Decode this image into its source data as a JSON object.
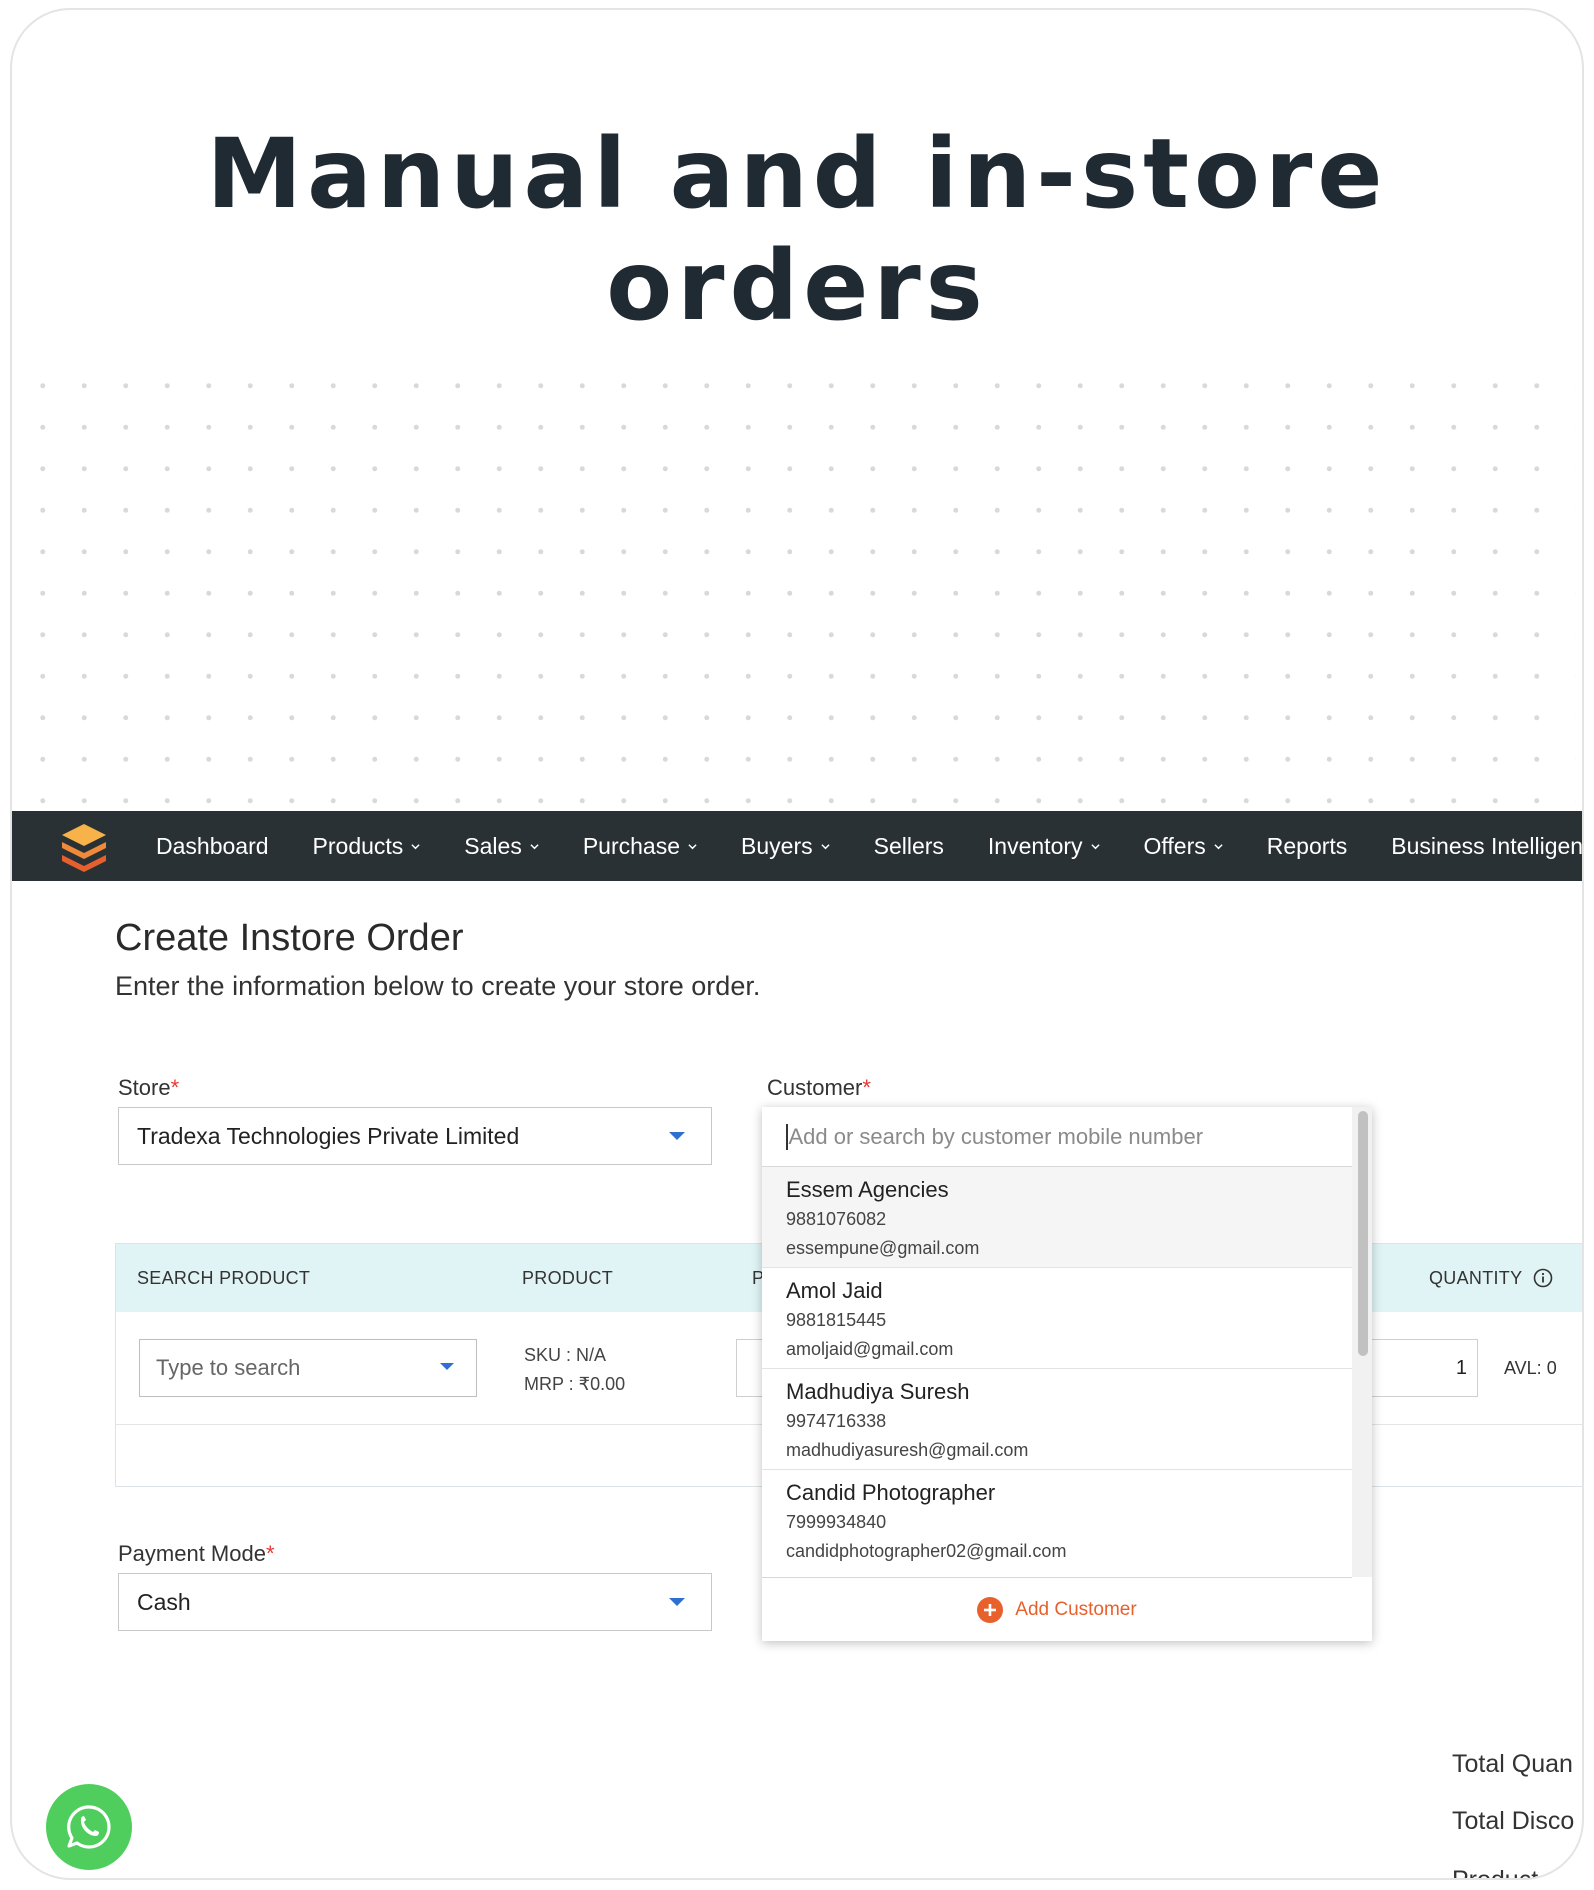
{
  "headline": "Manual and in-store orders",
  "nav": {
    "items": [
      {
        "label": "Dashboard",
        "dropdown": false
      },
      {
        "label": "Products",
        "dropdown": true
      },
      {
        "label": "Sales",
        "dropdown": true
      },
      {
        "label": "Purchase",
        "dropdown": true
      },
      {
        "label": "Buyers",
        "dropdown": true
      },
      {
        "label": "Sellers",
        "dropdown": false
      },
      {
        "label": "Inventory",
        "dropdown": true
      },
      {
        "label": "Offers",
        "dropdown": true
      },
      {
        "label": "Reports",
        "dropdown": false
      },
      {
        "label": "Business Intelligence",
        "dropdown": false
      }
    ]
  },
  "page": {
    "title": "Create Instore Order",
    "subtitle": "Enter the information below to create your store order."
  },
  "store": {
    "label": "Store",
    "required_mark": "*",
    "value": "Tradexa Technologies Private Limited"
  },
  "customer": {
    "label": "Customer",
    "required_mark": "*",
    "search_placeholder": "Add or search by customer mobile number",
    "options": [
      {
        "name": "Essem Agencies",
        "phone": "9881076082",
        "email": "essempune@gmail.com"
      },
      {
        "name": "Amol Jaid",
        "phone": "9881815445",
        "email": "amoljaid@gmail.com"
      },
      {
        "name": "Madhudiya Suresh",
        "phone": "9974716338",
        "email": "madhudiyasuresh@gmail.com"
      },
      {
        "name": "Candid Photographer",
        "phone": "7999934840",
        "email": "candidphotographer02@gmail.com"
      }
    ],
    "add_label": "Add Customer"
  },
  "table": {
    "headers": {
      "search_product": "SEARCH PRODUCT",
      "product": "PRODUCT",
      "partial": "P",
      "quantity": "QUANTITY"
    },
    "row": {
      "search_placeholder": "Type to search",
      "sku": "SKU :  N/A",
      "mrp": "MRP :  ₹0.00",
      "quantity": "1",
      "avl": "AVL: 0"
    }
  },
  "payment": {
    "label": "Payment Mode",
    "required_mark": "*",
    "value": "Cash"
  },
  "totals": {
    "quantity_label": "Total Quan",
    "discount_label": "Total Disco",
    "product_label": "Product"
  },
  "colors": {
    "nav_bg": "#2a3134",
    "table_header_bg": "#e0f4f6",
    "accent_orange": "#e8612c",
    "whatsapp_green": "#4fce5d",
    "required_red": "#e53935"
  }
}
